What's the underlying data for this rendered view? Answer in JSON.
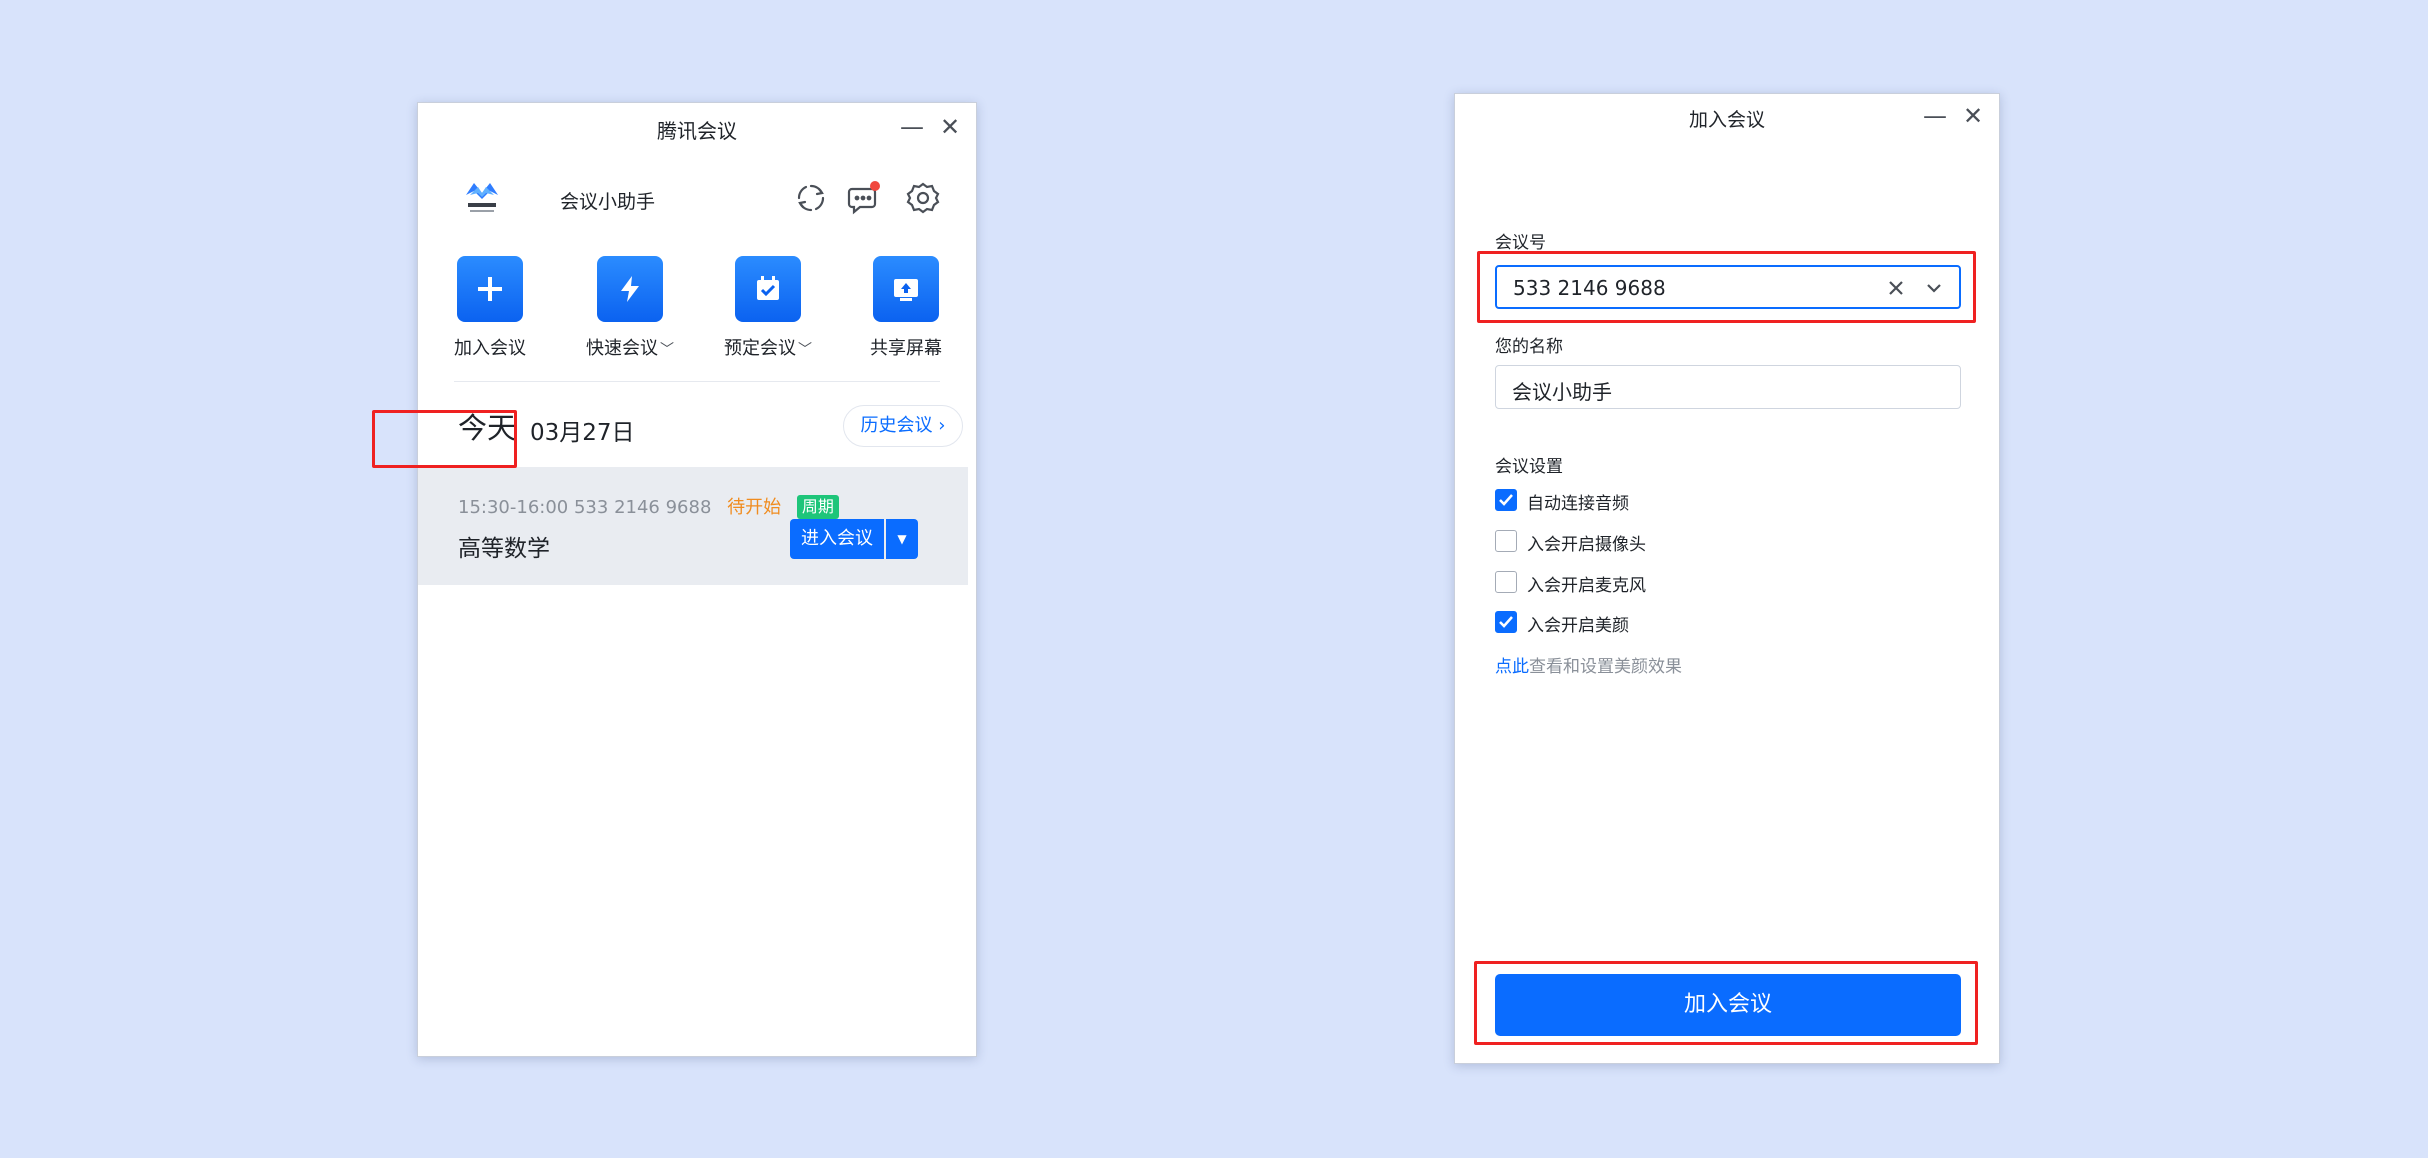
{
  "colors": {
    "background": "#d8e3fb",
    "accent": "#0a6cff",
    "highlight": "#ef2121",
    "pending": "#f08c1f",
    "badge": "#1ec57a"
  },
  "main_window": {
    "title": "腾讯会议",
    "minimize_icon": "minimize-icon",
    "close_icon": "close-icon",
    "profile": {
      "logo_text": "腾讯会议",
      "name": "会议小助手"
    },
    "header_icons": [
      "sync-icon",
      "message-icon",
      "settings-gear-icon"
    ],
    "actions": [
      {
        "label": "加入会议",
        "icon": "plus-icon",
        "has_dropdown": false
      },
      {
        "label": "快速会议",
        "icon": "lightning-icon",
        "has_dropdown": true
      },
      {
        "label": "预定会议",
        "icon": "calendar-check-icon",
        "has_dropdown": true
      },
      {
        "label": "共享屏幕",
        "icon": "share-screen-icon",
        "has_dropdown": false
      }
    ],
    "today": {
      "label": "今天",
      "date": "03月27日",
      "history_button": "历史会议"
    },
    "meeting": {
      "time": "15:30-16:00",
      "meeting_id": "533 2146 9688",
      "status": "待开始",
      "badge": "周期",
      "title": "高等数学",
      "enter_button": "进入会议",
      "enter_dropdown_icon": "caret-down-icon"
    }
  },
  "join_window": {
    "title": "加入会议",
    "minimize_icon": "minimize-icon",
    "close_icon": "close-icon",
    "meeting_number_label": "会议号",
    "meeting_number_value": "533 2146 9688",
    "your_name_label": "您的名称",
    "your_name_value": "会议小助手",
    "settings_label": "会议设置",
    "options": [
      {
        "label": "自动连接音频",
        "checked": true
      },
      {
        "label": "入会开启摄像头",
        "checked": false
      },
      {
        "label": "入会开启麦克风",
        "checked": false
      },
      {
        "label": "入会开启美颜",
        "checked": true
      }
    ],
    "hint_link": "点此",
    "hint_text": "查看和设置美颜效果",
    "join_button": "加入会议"
  }
}
